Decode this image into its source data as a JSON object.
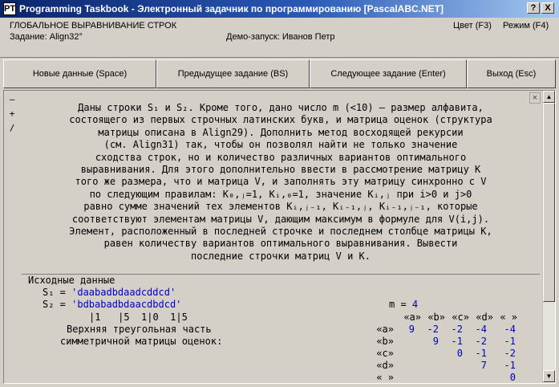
{
  "window": {
    "title": "Programming Taskbook - Электронный задачник по программированию [PascalABC.NET]",
    "icon": "PT",
    "help_label": "?",
    "close_label": "X"
  },
  "info": {
    "section": "ГЛОБАЛЬНОЕ ВЫРАВНИВАНИЕ СТРОК",
    "task": "Задание: Align32°",
    "demo": "Демо-запуск: Иванов Петр",
    "color": "Цвет (F3)",
    "mode": "Режим (F4)"
  },
  "toolbar": {
    "new_data": "Новые данные (Space)",
    "prev_task": "Предыдущее задание (BS)",
    "next_task": "Следующее задание (Enter)",
    "exit": "Выход (Esc)"
  },
  "panel": {
    "minus": "–",
    "plus": "+",
    "slash": "/",
    "close": "×"
  },
  "task_text": [
    "Даны строки S₁ и S₂. Кроме того, дано число m (<10) — размер алфавита,",
    "состоящего из первых строчных латинских букв, и матрица оценок (структура",
    "матрицы описана в Align29). Дополнить метод восходящей рекурсии",
    "(см. Align31) так, чтобы он позволял найти не только значение",
    "сходства строк, но и количество различных вариантов оптимального",
    "выравнивания. Для этого дополнительно ввести в рассмотрение матрицу K",
    "того же размера, что и матрица V, и заполнять эту матрицу синхронно с V",
    "по следующим правилам: K₀,ⱼ=1, Kᵢ,₀=1, значение Kᵢ,ⱼ при i>0 и j>0",
    "равно сумме значений тех элементов Kᵢ,ⱼ₋₁, Kᵢ₋₁,ⱼ, Kᵢ₋₁,ⱼ₋₁, которые",
    "соответствуют элементам матрицы V, дающим максимум в формуле для V(i,j).",
    "Элемент, расположенный в последней строчке и последнем столбце матрицы K,",
    "равен количеству вариантов оптимального выравнивания. Вывести",
    "последние строчки матриц V и K."
  ],
  "input": {
    "header": "Исходные данные",
    "s1_label": "S₁ = ",
    "s1_value": "'daabadbdaadcddcd'",
    "s2_label": "S₂ = ",
    "s2_value": "'bdbabadbdaacdbdcd'",
    "ruler": "|1   |5  1|0  1|5",
    "m_label": "m = ",
    "m_value": "4",
    "desc_line1": "Верхняя треугольная часть",
    "desc_line2": "симметричной матрицы оценок:",
    "matrix_cols": [
      "«a»",
      "«b»",
      "«c»",
      "«d»",
      "« »"
    ],
    "matrix_rows": [
      {
        "label": "«a»",
        "values": [
          "9",
          "-2",
          "-2",
          "-4",
          "-4"
        ]
      },
      {
        "label": "«b»",
        "values": [
          "",
          "9",
          "-1",
          "-2",
          "-1"
        ]
      },
      {
        "label": "«c»",
        "values": [
          "",
          "",
          "0",
          "-1",
          "-2"
        ]
      },
      {
        "label": "«d»",
        "values": [
          "",
          "",
          "",
          "7",
          "-1"
        ]
      },
      {
        "label": "« »",
        "values": [
          "",
          "",
          "",
          "",
          "0"
        ]
      }
    ]
  }
}
